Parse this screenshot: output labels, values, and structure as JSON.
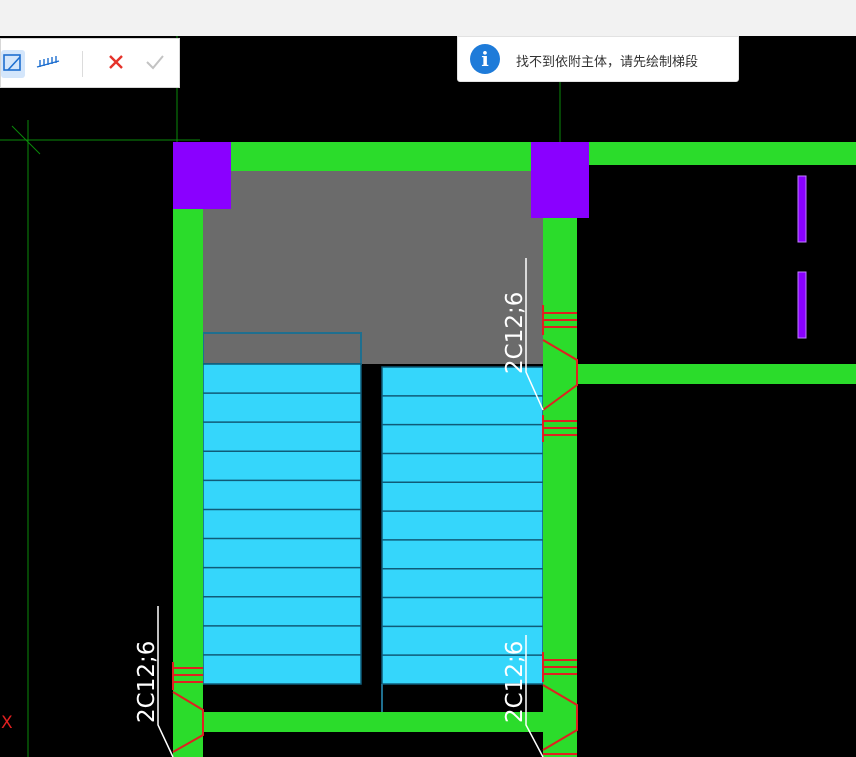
{
  "toolbar": {
    "tools": [
      {
        "icon": "stair-draw-icon",
        "active": true
      },
      {
        "icon": "stair-steps-icon",
        "active": false
      }
    ],
    "cancel_icon": "close-icon",
    "confirm_icon": "check-icon"
  },
  "message": {
    "icon": "info-icon",
    "icon_glyph": "i",
    "text": "找不到依附主体，请先绘制梯段"
  },
  "drawing": {
    "rebar_labels": [
      "2C12;6",
      "2C12;6",
      "2C12;6"
    ],
    "axis_marker": "X",
    "colors": {
      "wall": "#2bdc2b",
      "column": "#8a00ff",
      "stair_fill": "#35d6fb",
      "landing": "#6b6b6b",
      "rebar": "#e02020",
      "axis_line": "#0a8a0a",
      "label": "#ffffff"
    }
  }
}
